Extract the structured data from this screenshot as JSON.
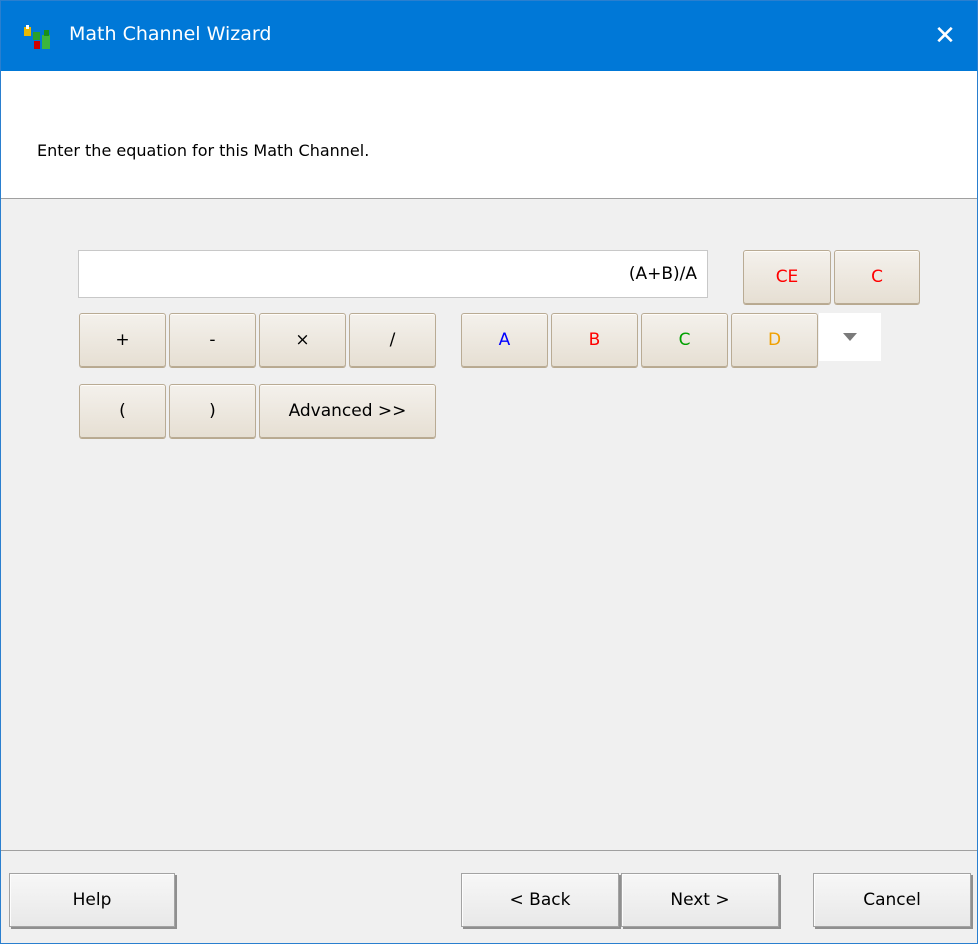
{
  "window": {
    "title": "Math Channel Wizard",
    "close_glyph": "✕",
    "icon": "math-channel-app-icon"
  },
  "header": {
    "instruction": "Enter the equation for this Math Channel."
  },
  "equation": {
    "value": "(A+B)/A"
  },
  "keypad": {
    "ce": "CE",
    "c": "C",
    "plus": "+",
    "minus": "-",
    "multiply": "×",
    "divide": "/",
    "channel_a": "A",
    "channel_b": "B",
    "channel_c": "C",
    "channel_d": "D",
    "open_paren": "(",
    "close_paren": ")",
    "advanced": "Advanced >>"
  },
  "colors": {
    "titlebar": "#0078d7",
    "clear_buttons": "#ff0000",
    "channel_a": "#0000ff",
    "channel_b": "#ff0000",
    "channel_c": "#00a000",
    "channel_d": "#f0a000"
  },
  "footer": {
    "help": "Help",
    "back": "< Back",
    "next": "Next >",
    "cancel": "Cancel"
  }
}
